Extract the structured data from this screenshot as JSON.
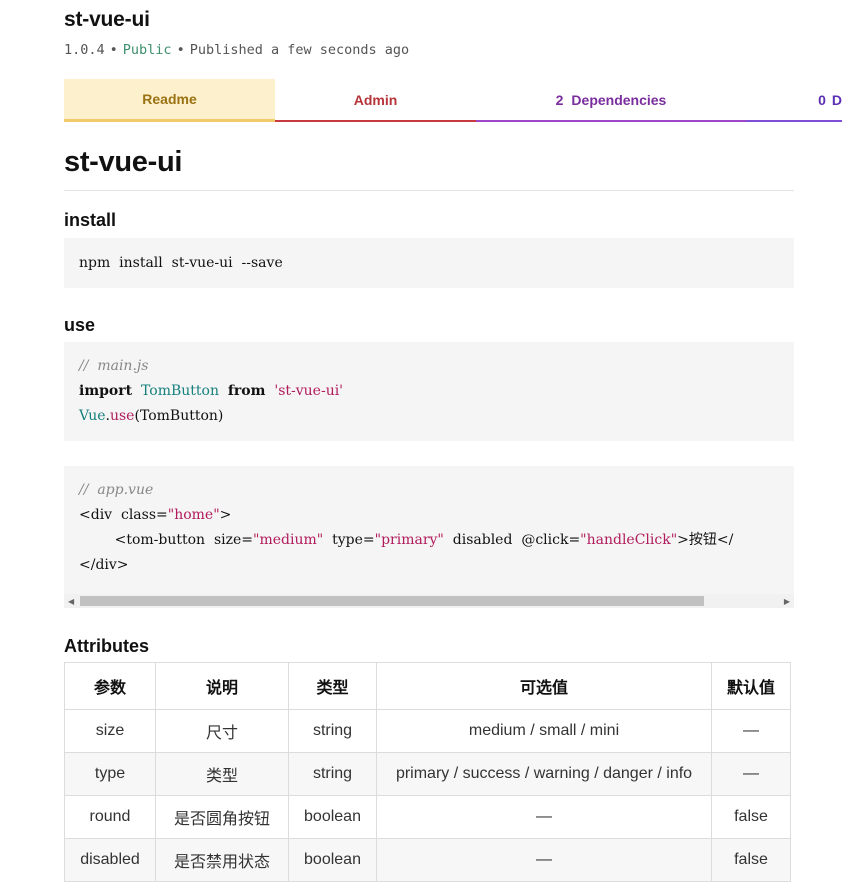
{
  "package": {
    "name": "st-vue-ui",
    "version": "1.0.4",
    "visibility": "Public",
    "published": "Published a few seconds ago",
    "separator": "•"
  },
  "tabs": [
    {
      "label": "Readme"
    },
    {
      "label": "Admin"
    },
    {
      "count": "2",
      "label": "Dependencies"
    },
    {
      "count": "0",
      "label": "D"
    }
  ],
  "readme": {
    "title": "st-vue-ui",
    "install_heading": "install",
    "install_code": "npm  install  st-vue-ui  --save",
    "use_heading": "use",
    "code1": {
      "comment": "//  main.js",
      "import_kw": "import",
      "import_name": "TomButton",
      "from_kw": "from",
      "module": "'st-vue-ui'",
      "vue": "Vue",
      "dot": ".",
      "use_fn": "use",
      "use_args": "(TomButton)"
    },
    "code2": {
      "comment": "//  app.vue",
      "div_open_start": "<div  class=",
      "div_class": "\"home\"",
      "div_open_end": ">",
      "btn_start": "<tom-button  size=",
      "size_val": "\"medium\"",
      "type_attr": "  type=",
      "type_val": "\"primary\"",
      "disabled_attr": "  disabled  @click=",
      "click_val": "\"handleClick\"",
      "btn_end": ">按钮</",
      "div_close": "</div>"
    },
    "attributes_heading": "Attributes",
    "table": {
      "headers": [
        "参数",
        "说明",
        "类型",
        "可选值",
        "默认值"
      ],
      "rows": [
        [
          "size",
          "尺寸",
          "string",
          "medium / small / mini",
          "—"
        ],
        [
          "type",
          "类型",
          "string",
          "primary / success / warning / danger / info",
          "—"
        ],
        [
          "round",
          "是否圆角按钮",
          "boolean",
          "—",
          "false"
        ],
        [
          "disabled",
          "是否禁用状态",
          "boolean",
          "—",
          "false"
        ]
      ]
    }
  },
  "colors": {
    "readme_tab": "#fdf0cc",
    "admin_tab": "#c63a40",
    "deps_tab": "#9c48c8",
    "code_bg": "#f5f5f5",
    "string_color": "#b11b5c",
    "teal_color": "#16807d"
  },
  "icons": {
    "scroll_left": "triangle-left",
    "scroll_right": "triangle-right"
  }
}
